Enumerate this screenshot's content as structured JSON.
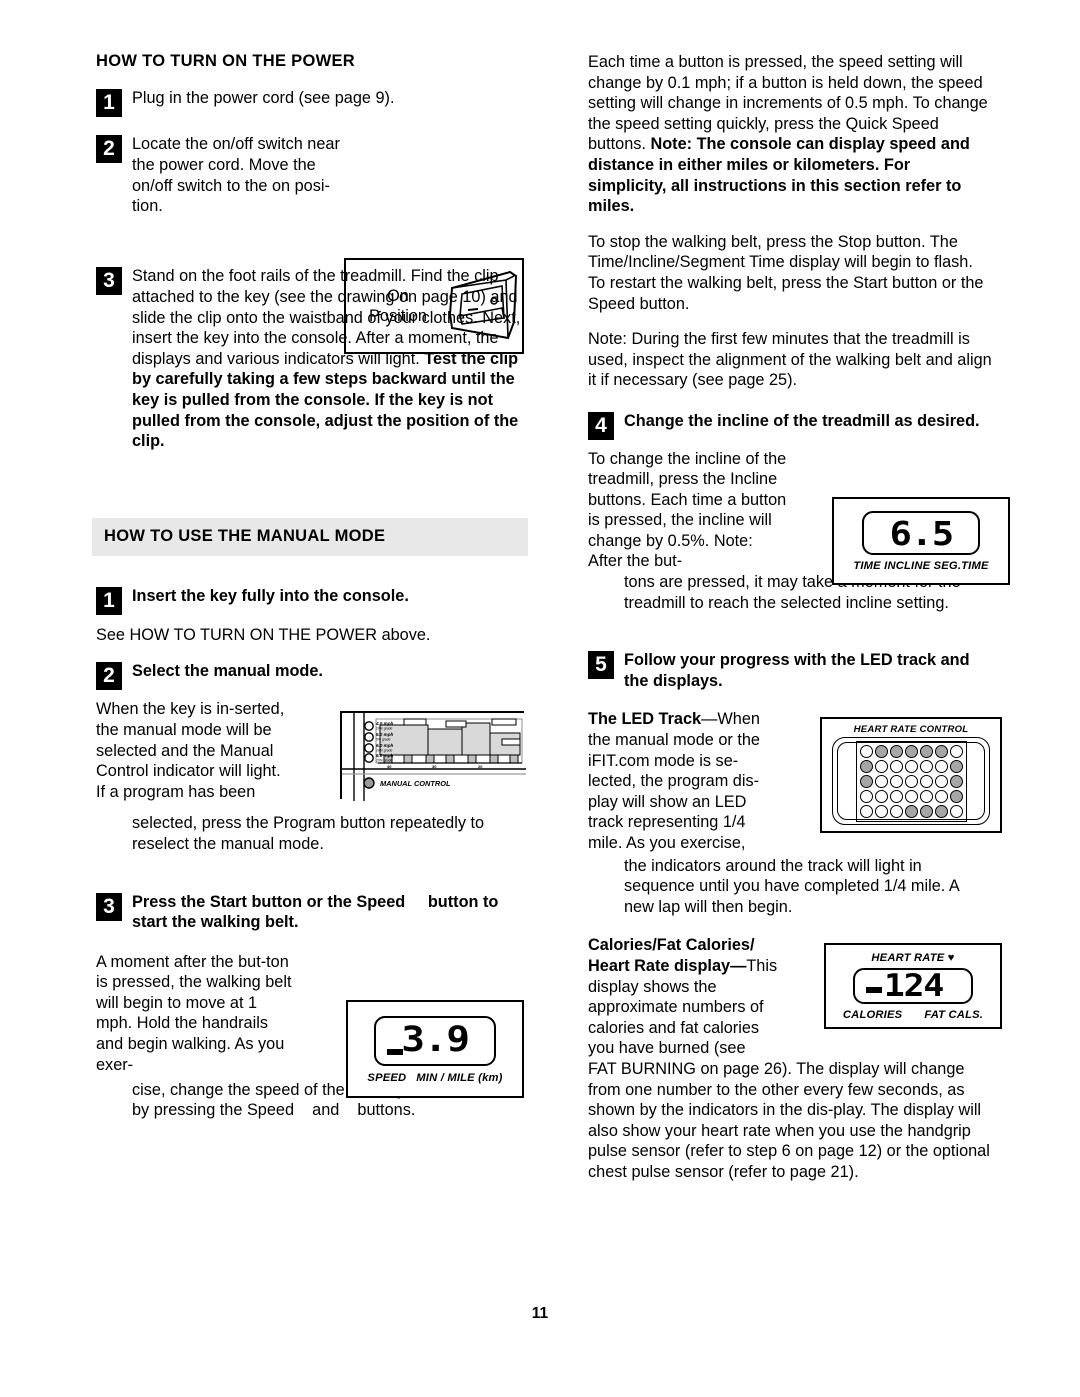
{
  "document": {
    "page_number": "11"
  },
  "left_column": {
    "section1": {
      "heading": "HOW TO TURN ON THE POWER",
      "steps": [
        {
          "number": "1",
          "text": "Plug in the power cord (see page 9)."
        },
        {
          "number": "2",
          "text": "Locate the on/off switch near the power cord. Move the on/off switch to the on posi-tion."
        },
        {
          "number": "3",
          "text_plain": "Stand on the foot rails of the treadmill. Find the clip attached to the key (see the drawing on page 10) and slide the clip onto the waistband of your clothes. Next, insert the key into the console. After a moment, the displays and various indicators will light. ",
          "text_bold": "Test the clip by carefully taking a few steps backward until the key is pulled from the console. If the key is not pulled from the console, adjust the position of the clip."
        }
      ],
      "figure_on_position": {
        "line1": "On",
        "line2": "Position",
        "icon": "rocker-switch-on-illustration"
      }
    },
    "section2": {
      "heading": "HOW TO USE THE MANUAL MODE",
      "steps": [
        {
          "number": "1",
          "title": "Insert the key fully into the console.",
          "body": "See HOW TO TURN ON THE POWER above."
        },
        {
          "number": "2",
          "title": "Select the manual mode.",
          "body_wrap": "When the key is in-serted, the manual mode will be selected and the Manual Control indicator will light. If a program has been",
          "body_full": "selected, press the Program button repeatedly to reselect the manual mode."
        },
        {
          "number": "3",
          "title_part1": "Press the Start button or the Speed",
          "title_part2": "button to start the walking belt.",
          "body_wrap": "A moment after the but-ton is pressed, the walking belt will begin to move at 1 mph. Hold the handrails and begin walking. As you exer-",
          "body_full_part1": "cise, change the speed of the walking belt as de-sired by pressing the Speed",
          "body_full_part2": "and",
          "body_full_part3": "buttons."
        }
      ],
      "figure_manual_control": {
        "label": "MANUAL CONTROL",
        "speed_labels": [
          {
            "speed": "4.5 mph",
            "grade": "10% grade"
          },
          {
            "speed": "5.0 mph",
            "grade": "0% grade"
          },
          {
            "speed": "6.0 mph",
            "grade": "10% grade"
          },
          {
            "speed": "6.0 mph",
            "grade": "10% grade"
          }
        ],
        "axis_ticks": [
          "40",
          "30",
          "20"
        ]
      },
      "figure_speed_display": {
        "value": "3.9",
        "caption_left": "SPEED",
        "caption_right": "MIN / MILE (km)"
      }
    }
  },
  "right_column": {
    "paragraphs": [
      {
        "plain": "Each time a button is pressed, the speed setting will change by 0.1 mph; if a button is held down, the speed setting will change in increments of 0.5 mph. To change the speed setting quickly, press the Quick Speed buttons. ",
        "bold": "Note: The console can display speed and distance in either miles or kilometers. For simplicity, all instructions in this section refer to miles."
      },
      {
        "plain": "To stop the walking belt, press the Stop button. The Time/Incline/Segment Time display will begin to flash. To restart the walking belt, press the Start button or the Speed     button.",
        "bold": ""
      },
      {
        "plain": "Note: During the first few minutes that the treadmill is used, inspect the alignment of the walking belt and align it if necessary (see page 25).",
        "bold": ""
      }
    ],
    "steps": [
      {
        "number": "4",
        "title": "Change the incline of the treadmill as desired.",
        "body_wrap": "To change the incline of the treadmill, press the Incline buttons. Each time a button is pressed, the incline will change by 0.5%. Note: After the but-",
        "body_full": "tons are pressed, it may take a moment for the treadmill to reach the selected incline setting."
      },
      {
        "number": "5",
        "title": "Follow your progress with the LED track and the displays.",
        "sub1_bold": "The LED Track",
        "sub1_plain": "—When the manual mode or the iFIT.com mode is se-lected, the program dis-play will show an LED track representing 1/4 mile. As you exercise,",
        "sub1_full": "the indicators around the track will light in sequence until you have completed 1/4 mile. A new lap will then begin.",
        "sub2_bold": "Calories/Fat Calories/ Heart Rate display—",
        "sub2_plain": "This display shows the approximate numbers of calories and fat calories you have burned (see",
        "sub2_full": "FAT BURNING on page 26). The display will change from one number to the other every few seconds, as shown by the indicators in the dis-play. The display will also show your heart rate when you use the handgrip pulse sensor (refer to step 6 on page 12) or the optional chest pulse sensor (refer to page 21)."
      }
    ],
    "figure_incline_display": {
      "value": "6.5",
      "caption": "TIME  INCLINE  SEG.TIME"
    },
    "figure_led_track": {
      "title": "HEART RATE  CONTROL",
      "grid": [
        [
          0,
          1,
          1,
          1,
          1,
          1,
          0
        ],
        [
          1,
          0,
          0,
          0,
          0,
          0,
          1
        ],
        [
          1,
          0,
          0,
          0,
          0,
          0,
          1
        ],
        [
          0,
          0,
          0,
          0,
          0,
          0,
          1
        ],
        [
          0,
          0,
          0,
          1,
          1,
          1,
          0
        ]
      ]
    },
    "figure_heart_rate_display": {
      "value": "124",
      "caption_top": "HEART RATE",
      "heart_symbol": "♥",
      "caption_left": "CALORIES",
      "caption_right": "FAT CALS."
    }
  },
  "colors": {
    "banner_background": "#e8e8e8",
    "led_on": "#a6a6a6",
    "ink": "#000000"
  }
}
